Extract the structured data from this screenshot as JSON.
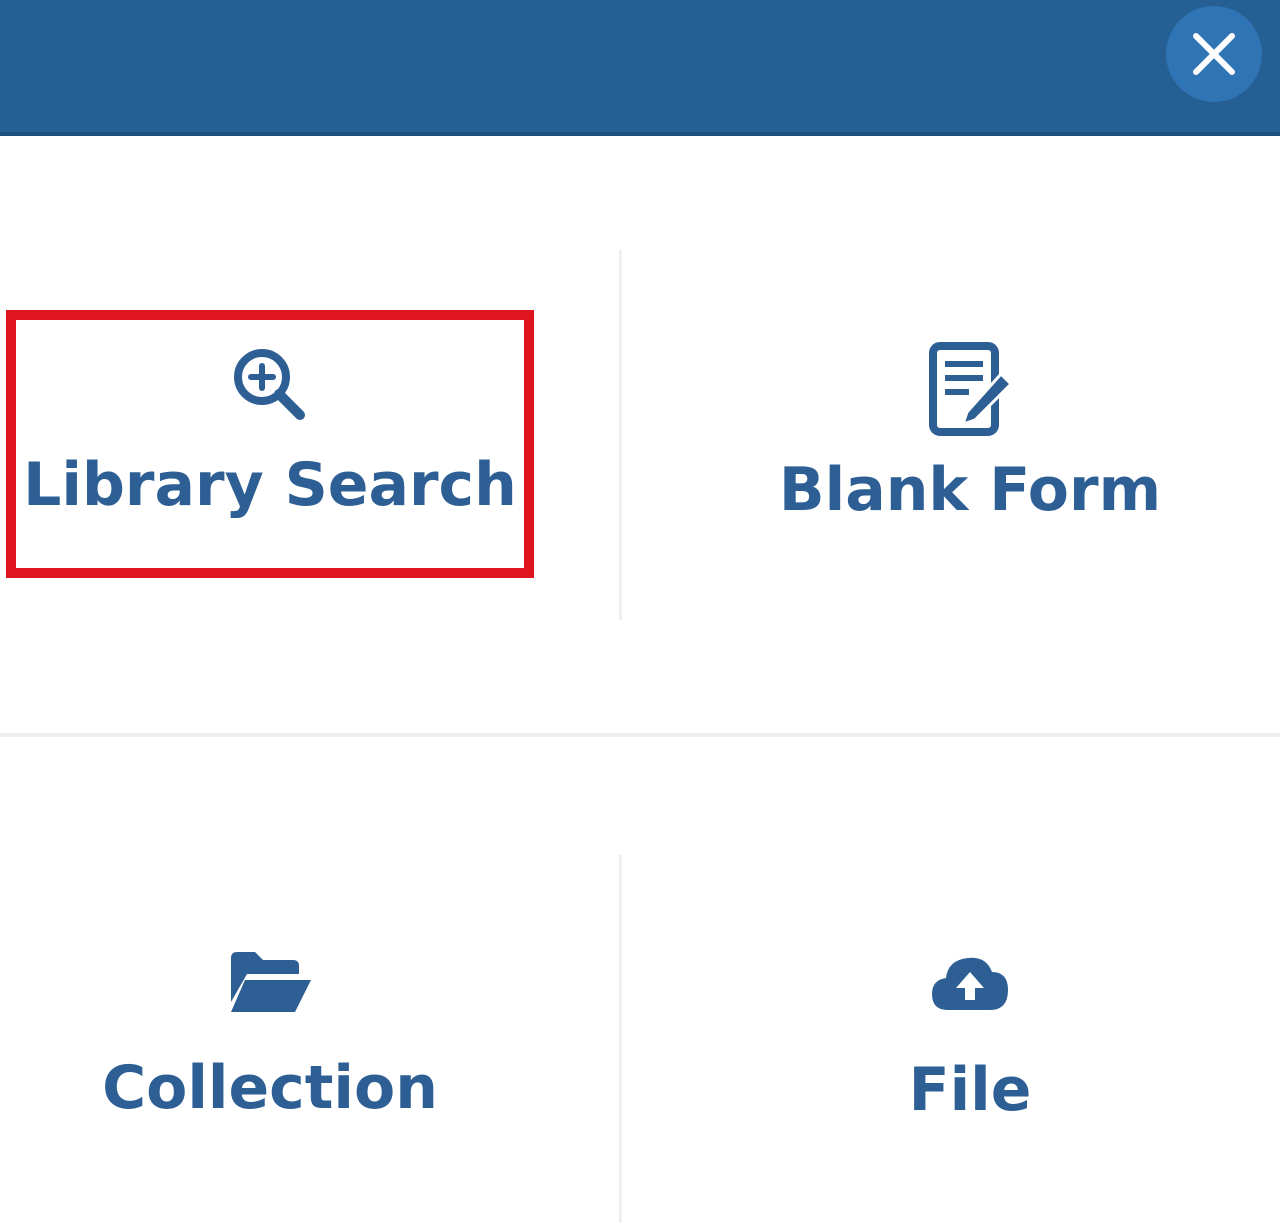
{
  "dialog": {
    "close_icon": "close-icon",
    "header_color": "#265f93"
  },
  "options": [
    {
      "label": "Library Search",
      "icon": "search-plus-icon"
    },
    {
      "label": "Blank Form",
      "icon": "form-edit-icon"
    },
    {
      "label": "Collection",
      "icon": "folder-open-icon"
    },
    {
      "label": "File",
      "icon": "cloud-upload-icon"
    }
  ],
  "highlight": {
    "target": "Library Search",
    "color": "#e0141e"
  },
  "accent_color": "#2d5f94"
}
